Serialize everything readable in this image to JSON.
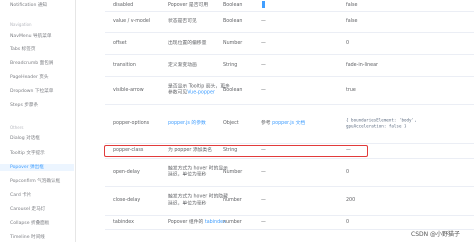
{
  "sidebar": {
    "items": [
      {
        "label": "Notification 通知",
        "kind": "item"
      },
      {
        "label": "Navigation",
        "kind": "group"
      },
      {
        "label": "NavMenu 导航菜单",
        "kind": "item"
      },
      {
        "label": "Tabs 标签页",
        "kind": "item"
      },
      {
        "label": "Breadcrumb 面包屑",
        "kind": "item"
      },
      {
        "label": "PageHeader 页头",
        "kind": "item"
      },
      {
        "label": "Dropdown 下拉菜单",
        "kind": "item"
      },
      {
        "label": "Steps 步骤条",
        "kind": "item"
      },
      {
        "label": "Others",
        "kind": "group"
      },
      {
        "label": "Dialog 对话框",
        "kind": "item"
      },
      {
        "label": "Tooltip 文字提示",
        "kind": "item"
      },
      {
        "label": "Popover 弹出框",
        "kind": "active"
      },
      {
        "label": "Popconfirm 气泡确认框",
        "kind": "item"
      },
      {
        "label": "Card 卡片",
        "kind": "item"
      },
      {
        "label": "Carousel 走马灯",
        "kind": "item"
      },
      {
        "label": "Collapse 折叠面板",
        "kind": "item"
      },
      {
        "label": "Timeline 时间线",
        "kind": "item"
      }
    ]
  },
  "table": {
    "rows": [
      {
        "attr": "disabled",
        "desc": "Popover 是否可用",
        "type": "Boolean",
        "options": "—",
        "default": "false"
      },
      {
        "attr": "value / v-model",
        "desc": "状态是否可见",
        "type": "Boolean",
        "options": "—",
        "default": "false"
      },
      {
        "attr": "offset",
        "desc": "出现位置的偏移量",
        "type": "Number",
        "options": "—",
        "default": "0"
      },
      {
        "attr": "transition",
        "desc": "定义渐变动画",
        "type": "String",
        "options": "—",
        "default": "fade-in-linear"
      },
      {
        "attr": "visible-arrow",
        "desc": "是否显示 Tooltip 箭头，更多参数可见",
        "desc_link": "Vue-popper",
        "type": "Boolean",
        "options": "—",
        "default": "true"
      },
      {
        "attr": "popper-options",
        "desc": "",
        "desc_link": "popper.js 的参数",
        "type": "Object",
        "options": "参考",
        "options_link": "popper.js 文档",
        "default": "{ boundariesElement: 'body', gpuAcceleration: false }"
      },
      {
        "attr": "popper-class",
        "desc": "为 popper 添加类名",
        "type": "String",
        "options": "—",
        "default": "—"
      },
      {
        "attr": "open-delay",
        "desc": "触发方式为 hover 时的显示延迟，单位为毫秒",
        "type": "Number",
        "options": "—",
        "default": "0"
      },
      {
        "attr": "close-delay",
        "desc": "触发方式为 hover 时的隐藏延迟，单位为毫秒",
        "type": "number",
        "options": "—",
        "default": "200"
      },
      {
        "attr": "tabindex",
        "desc": "Popover 组件的",
        "desc_link": "tabindex",
        "type": "number",
        "options": "—",
        "default": "0"
      }
    ]
  },
  "watermark": "CSDN @小野猫子",
  "colors": {
    "accent": "#409eff",
    "highlight": "#e13b3b"
  }
}
